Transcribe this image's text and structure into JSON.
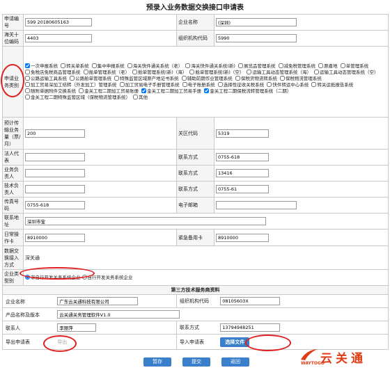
{
  "title": "预录入业务数据交换接口申请表",
  "rows": {
    "apply_no": {
      "label": "申请编号",
      "value": "599 20180605163"
    },
    "company_name": {
      "label": "企业名称",
      "value": "(深圳)"
    },
    "customs_code": {
      "label": "海关十位编码",
      "value": "4403"
    },
    "org_code": {
      "label": "组织机构代码",
      "value": "5990"
    },
    "systems_label": "申请业务类别",
    "systems": [
      {
        "label": "一次申报系统",
        "checked": true
      },
      {
        "label": "转关单系统",
        "checked": false
      },
      {
        "label": "集中申报系统",
        "checked": false
      },
      {
        "label": "海关快件通关系统（老）",
        "checked": false
      },
      {
        "label": "海关快件通关系统(新)",
        "checked": false
      },
      {
        "label": "展览品管理系统",
        "checked": false
      },
      {
        "label": "减免税管理系统",
        "checked": false
      },
      {
        "label": "原產地",
        "checked": false
      },
      {
        "label": "单管理系统",
        "checked": false
      },
      {
        "label": "免税店免税商品管理系统",
        "checked": false
      },
      {
        "label": "舱单管理系统（老）",
        "checked": false
      },
      {
        "label": "舱单管理系统(新)（海）",
        "checked": false
      },
      {
        "label": "舱单管理系统(新)（空）",
        "checked": false
      },
      {
        "label": "运输工具动态管理系统（海）",
        "checked": false
      },
      {
        "label": "运输工具动态管理系统（空）",
        "checked": false
      },
      {
        "label": "公路运输工具系统",
        "checked": false
      },
      {
        "label": "公路舱单管理系统",
        "checked": false
      },
      {
        "label": "特殊监管区域原产地证书系统",
        "checked": false
      },
      {
        "label": "辅助前期作业管理系统",
        "checked": false
      },
      {
        "label": "保税货物流转系统",
        "checked": false
      },
      {
        "label": "保税物流管理系统",
        "checked": false
      },
      {
        "label": "加工贸易深加工结转（外发加工）管理系统",
        "checked": false
      },
      {
        "label": "加工贸易电子手册管理系统",
        "checked": false
      },
      {
        "label": "电子账册系统",
        "checked": false
      },
      {
        "label": "选择性征收关税系统",
        "checked": false
      },
      {
        "label": "快件转运中心系统",
        "checked": false
      },
      {
        "label": "转关运抵报告系统",
        "checked": false
      },
      {
        "label": "随附单据附件交换系统",
        "checked": false
      },
      {
        "label": "金关工程二期加工贸易账册",
        "checked": false
      },
      {
        "label": "金关工程二期加工贸易手册",
        "checked": true
      },
      {
        "label": "金关工程二期保税流转管理系统（二期）",
        "checked": true
      },
      {
        "label": "金关工程二期特殊监管区域（保税物流管理系统）",
        "checked": false
      },
      {
        "label": "其他",
        "checked": false
      }
    ],
    "expected_volume": {
      "label": "预计传输业务量（票/月）",
      "value": "200"
    },
    "customs_area_code": {
      "label": "关区代码",
      "value": "5319"
    },
    "legal_rep": {
      "label": "法人代表",
      "value": ""
    },
    "phone1": {
      "label": "联系方式",
      "value": "0755-618"
    },
    "business_contact": {
      "label": "业务负责人",
      "value": ""
    },
    "phone2": {
      "label": "联系方式",
      "value": "13416"
    },
    "tech_contact": {
      "label": "技术负责人",
      "value": ""
    },
    "phone3": {
      "label": "联系方式",
      "value": "0755-61"
    },
    "fax": {
      "label": "传真号码",
      "value": "0755-618"
    },
    "email": {
      "label": "电子邮箱",
      "value": ""
    },
    "address": {
      "label": "联系地址",
      "value": "深圳市宝"
    },
    "daily_card": {
      "label": "日常操作卡",
      "value": "8910000"
    },
    "emergency_card": {
      "label": "紧急备用卡",
      "value": "8910000"
    },
    "exchange_mode": {
      "label": "数据交换接入方式",
      "value": "深关通"
    },
    "dev_type": {
      "label": "企业类型别",
      "options": [
        {
          "label": "非自行开发关务系统企业",
          "checked": true
        },
        {
          "label": "自行开发关务系统企业",
          "checked": false
        }
      ]
    }
  },
  "third_party": {
    "heading": "第三方技术服务商资料",
    "company_name": {
      "label": "企业名称",
      "value": "广东云关通科技有限公司"
    },
    "org_code": {
      "label": "组织机构代码",
      "value": "08105603X"
    },
    "product": {
      "label": "产品名称及版本",
      "value": "云关通关务管理软件V1.0"
    },
    "contact": {
      "label": "联系人",
      "value": "李丽萍"
    },
    "phone": {
      "label": "联系方式",
      "value": "13794948251"
    },
    "export_label": "导出申请表",
    "export_link": "导出",
    "import_label": "导入申请表",
    "import_button": "选择文件"
  },
  "actions": {
    "save": "暂存",
    "submit": "提交",
    "back": "返回"
  },
  "logo": {
    "zh": "云关通",
    "en": "WAYTOGO"
  },
  "colors": {
    "accent": "#3a7fcc",
    "highlight": "#e02020",
    "brand": "#e03c14"
  }
}
